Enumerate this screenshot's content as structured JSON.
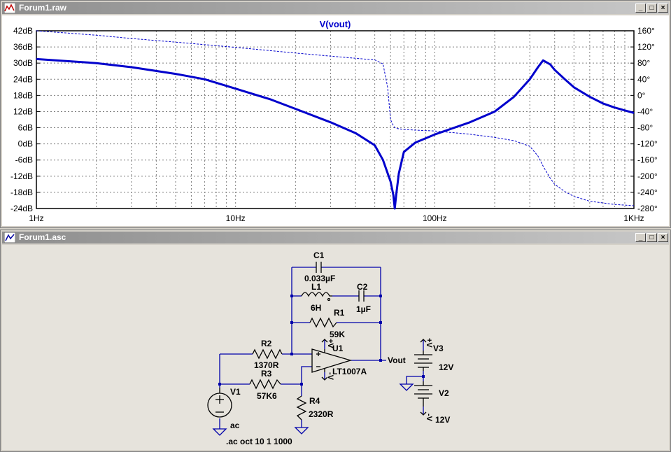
{
  "plot_window": {
    "title": "Forum1.raw",
    "trace_name": "V(vout)",
    "y_left_labels": [
      "42dB",
      "36dB",
      "30dB",
      "24dB",
      "18dB",
      "12dB",
      "6dB",
      "0dB",
      "-6dB",
      "-12dB",
      "-18dB",
      "-24dB"
    ],
    "y_right_labels": [
      "160°",
      "120°",
      "80°",
      "40°",
      "0°",
      "-40°",
      "-80°",
      "-120°",
      "-160°",
      "-200°",
      "-240°",
      "-280°"
    ],
    "x_labels": [
      "1Hz",
      "10Hz",
      "100Hz",
      "1KHz"
    ],
    "trace_color": "#0000cc"
  },
  "chart_data": {
    "type": "line",
    "title": "V(vout)",
    "xscale": "log",
    "xlim": [
      1,
      1000
    ],
    "ylim": [
      -24,
      42
    ],
    "y2lim": [
      -280,
      160
    ],
    "grid": true,
    "series": [
      {
        "name": "V(vout)",
        "axis": "left",
        "x": [
          1,
          2,
          3,
          5,
          7,
          10,
          15,
          20,
          30,
          40,
          50,
          55,
          60,
          62,
          63,
          64,
          66,
          70,
          80,
          100,
          150,
          200,
          250,
          300,
          330,
          350,
          380,
          400,
          450,
          500,
          600,
          700,
          800,
          1000
        ],
        "y": [
          31.5,
          30,
          28.5,
          26,
          24,
          20.5,
          16.5,
          13,
          8,
          4,
          -0.5,
          -6,
          -14,
          -19,
          -24,
          -19,
          -11,
          -3,
          0.5,
          3.5,
          8,
          12,
          17.5,
          24,
          28.5,
          31,
          29.5,
          27.5,
          24,
          21,
          17.5,
          15,
          13.5,
          11.5
        ]
      },
      {
        "name": "V(vout)",
        "axis": "right",
        "x": [
          1,
          2,
          3,
          5,
          10,
          20,
          40,
          50,
          55,
          58,
          60,
          62,
          63,
          65,
          70,
          80,
          100,
          150,
          200,
          250,
          300,
          330,
          350,
          380,
          400,
          450,
          500,
          600,
          800,
          1000
        ],
        "y": [
          160,
          149,
          141,
          132,
          119,
          105,
          92,
          88,
          78,
          20,
          -60,
          -75,
          -80,
          -82,
          -84,
          -86,
          -88,
          -96,
          -104,
          -112,
          -126,
          -150,
          -175,
          -205,
          -220,
          -238,
          -250,
          -262,
          -270,
          -273
        ]
      }
    ]
  },
  "schematic_window": {
    "title": "Forum1.asc",
    "labels": {
      "c1": "C1",
      "c1_val": "0.033µF",
      "l1": "L1",
      "l1_val": "6H",
      "c2": "C2",
      "c2_val": "1µF",
      "r1": "R1",
      "r1_val": "59K",
      "r2": "R2",
      "r2_val": "1370R",
      "r3": "R3",
      "r3_val": "57K6",
      "r4": "R4",
      "r4_val": "2320R",
      "u1": "U1",
      "u1_val": "LT1007A",
      "v1": "V1",
      "v1_val": "ac",
      "v2": "V2",
      "v2_val": "12V",
      "v3": "V3",
      "v3_val": "12V",
      "vout": "Vout",
      "plus_v": "+V",
      "minus_v": "-V",
      "directive": ".ac oct 10 1 1000"
    }
  },
  "window_buttons": {
    "minimize": "_",
    "maximize": "□",
    "close": "×"
  }
}
